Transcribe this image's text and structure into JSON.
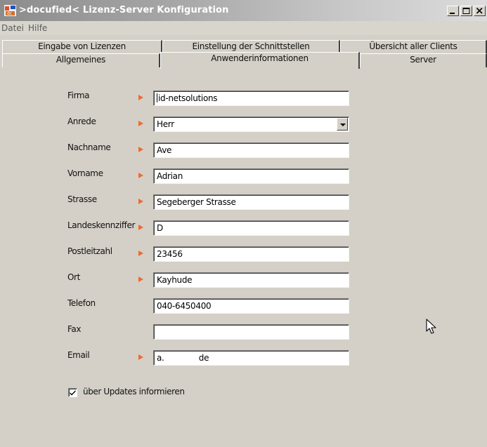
{
  "window": {
    "title": ">docufied< Lizenz-Server Konfiguration",
    "icon": "docufied-app-icon",
    "controls": [
      "minimize-icon",
      "maximize-icon",
      "close-icon"
    ]
  },
  "menu": {
    "items": [
      "Datei",
      "Hilfe"
    ]
  },
  "tabs": {
    "row1": [
      "Eingabe von Lizenzen",
      "Einstellung der Schnittstellen",
      "Übersicht aller Clients"
    ],
    "row2": [
      "Allgemeines",
      "Anwenderinformationen",
      "Server"
    ],
    "active": "Anwenderinformationen"
  },
  "form": {
    "fields": [
      {
        "label": "Firma",
        "value": "id-netsolutions",
        "required": true
      },
      {
        "label": "Anrede",
        "value": "Herr",
        "required": true,
        "type": "select"
      },
      {
        "label": "Nachname",
        "value": "Ave",
        "required": true
      },
      {
        "label": "Vorname",
        "value": "Adrian",
        "required": true
      },
      {
        "label": "Strasse",
        "value": "Segeberger Strasse",
        "required": true
      },
      {
        "label": "Landeskennziffer",
        "value": "D",
        "required": true
      },
      {
        "label": "Postleitzahl",
        "value": "23456",
        "required": true
      },
      {
        "label": "Ort",
        "value": "Kayhude",
        "required": true
      },
      {
        "label": "Telefon",
        "value": "040-6450400",
        "required": false
      },
      {
        "label": "Fax",
        "value": "",
        "required": false
      },
      {
        "label": "Email",
        "value": "a.              de",
        "required": true
      }
    ],
    "updates_checkbox": {
      "label": "über Updates informieren",
      "checked": true
    }
  },
  "colors": {
    "required_marker": "#f06a30",
    "panel": "#d4d0c7"
  }
}
